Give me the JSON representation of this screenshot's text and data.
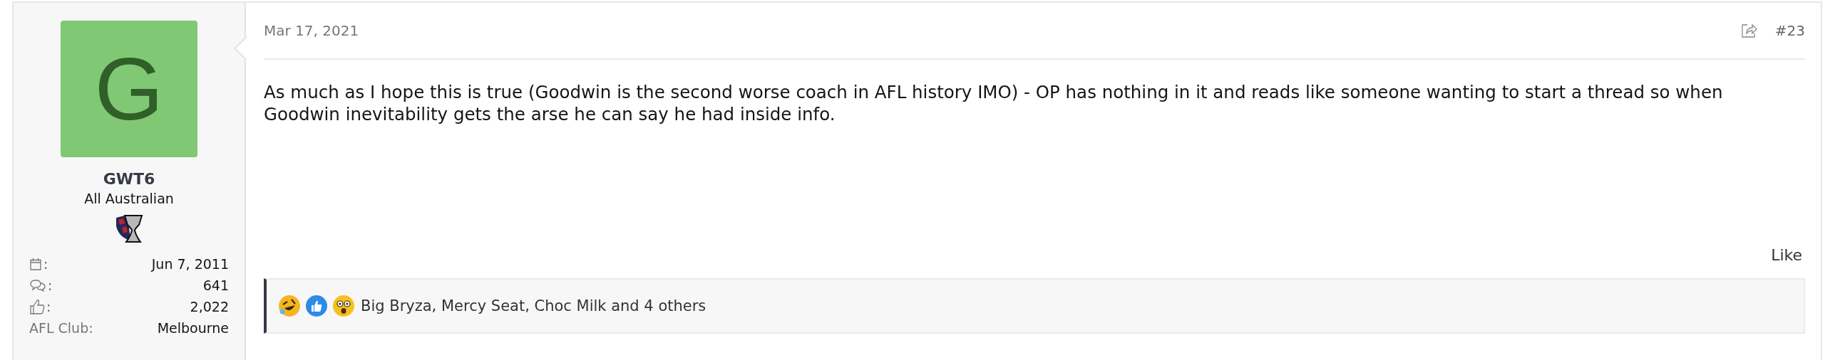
{
  "user": {
    "avatar_letter": "G",
    "name": "GWT6",
    "title": "All Australian",
    "stats": [
      {
        "kind": "joined",
        "label": ":",
        "value": "Jun 7, 2011"
      },
      {
        "kind": "messages",
        "label": ":",
        "value": "641"
      },
      {
        "kind": "reactions",
        "label": ":",
        "value": "2,022"
      },
      {
        "kind": "text",
        "label": "AFL Club:",
        "value": "Melbourne"
      }
    ]
  },
  "post": {
    "date": "Mar 17, 2021",
    "number": "#23",
    "body": "As much as I hope this is true (Goodwin is the second worse coach in AFL history IMO) - OP has nothing in it and reads like someone wanting to start a thread so when Goodwin inevitability gets the arse he can say he had inside info.",
    "like": "Like",
    "reactions_text": "Big Bryza, Mercy Seat, Choc Milk and 4 others"
  }
}
